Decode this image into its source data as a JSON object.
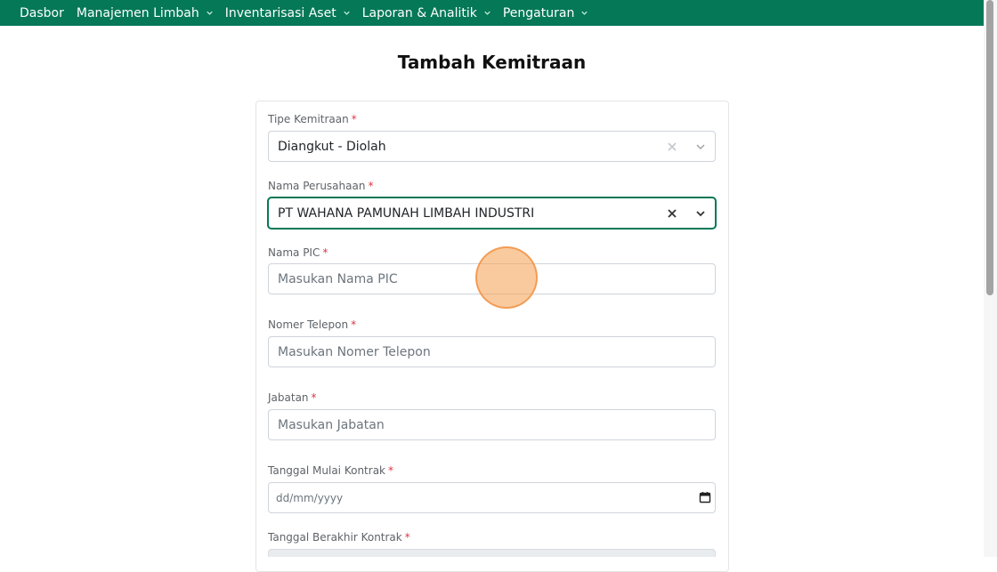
{
  "navbar": {
    "items": [
      {
        "label": "Dasbor",
        "has_dropdown": false
      },
      {
        "label": "Manajemen Limbah",
        "has_dropdown": true
      },
      {
        "label": "Inventarisasi Aset",
        "has_dropdown": true
      },
      {
        "label": "Laporan & Analitik",
        "has_dropdown": true
      },
      {
        "label": "Pengaturan",
        "has_dropdown": true
      }
    ],
    "background": "#047857"
  },
  "page": {
    "title": "Tambah Kemitraan"
  },
  "form": {
    "required_mark": "*",
    "tipe_kemitraan": {
      "label": "Tipe Kemitraan",
      "value": "Diangkut - Diolah"
    },
    "nama_perusahaan": {
      "label": "Nama Perusahaan",
      "value": "PT WAHANA PAMUNAH LIMBAH INDUSTRI"
    },
    "nama_pic": {
      "label": "Nama PIC",
      "placeholder": "Masukan Nama PIC"
    },
    "nomer_telepon": {
      "label": "Nomer Telepon",
      "placeholder": "Masukan Nomer Telepon"
    },
    "jabatan": {
      "label": "Jabatan",
      "placeholder": "Masukan Jabatan"
    },
    "tanggal_mulai": {
      "label": "Tanggal Mulai Kontrak",
      "placeholder": "dd/mm/yyyy"
    },
    "tanggal_berakhir": {
      "label": "Tanggal Berakhir Kontrak"
    }
  },
  "icons": {
    "clear": "close-icon",
    "dropdown": "chevron-down-icon",
    "calendar": "calendar-icon"
  },
  "colors": {
    "accent": "#047857",
    "required": "#dc3545",
    "click_marker": "#f59e50"
  }
}
